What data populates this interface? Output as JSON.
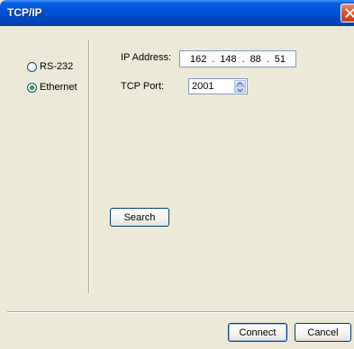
{
  "window": {
    "title": "TCP/IP"
  },
  "connection": {
    "rs232_label": "RS-232",
    "ethernet_label": "Ethernet",
    "selected": "Ethernet"
  },
  "ethernet": {
    "ip_label": "IP Address:",
    "ip": [
      "162",
      "148",
      "88",
      "51"
    ],
    "ip_separator": ".",
    "port_label": "TCP Port:",
    "port": "2001"
  },
  "buttons": {
    "search": "Search",
    "connect": "Connect",
    "cancel": "Cancel"
  }
}
